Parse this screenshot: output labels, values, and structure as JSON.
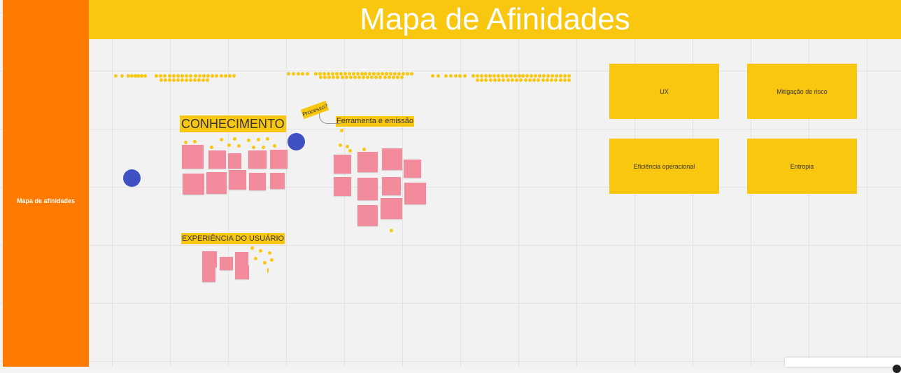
{
  "board": {
    "title": "Mapa de Afinidades",
    "frame_label": "Mapa de afinidades"
  },
  "categories": [
    {
      "label": "UX"
    },
    {
      "label": "Mitigação de risco"
    },
    {
      "label": "Eficiência operacional"
    },
    {
      "label": "Entropia"
    }
  ],
  "groups": {
    "conhecimento": "CONHECIMENTO",
    "ferramenta": "Ferramenta e emissão",
    "experiencia": "EXPERIÊNCIA DO USUÁRIO"
  },
  "tag": "Processo?",
  "colors": {
    "sidebar": "#ff7a00",
    "title_bar": "#fac710",
    "sticky_yellow": "#fac710",
    "sticky_pink": "#f28b9b",
    "circle": "#4051c3"
  }
}
